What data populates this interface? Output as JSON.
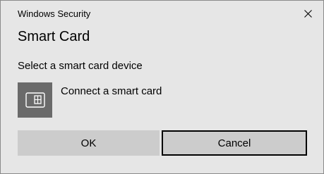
{
  "window": {
    "title": "Windows Security",
    "close_icon": "close-icon"
  },
  "dialog": {
    "heading": "Smart Card",
    "prompt": "Select a smart card device"
  },
  "device_option": {
    "icon": "smart-card-reader-icon",
    "label": "Connect a smart card"
  },
  "buttons": {
    "ok_label": "OK",
    "cancel_label": "Cancel",
    "focused": "cancel"
  },
  "colors": {
    "dialog_background": "#e6e6e6",
    "button_background": "#cccccc",
    "device_tile": "#6a6a6a",
    "focus_border": "#000000"
  }
}
